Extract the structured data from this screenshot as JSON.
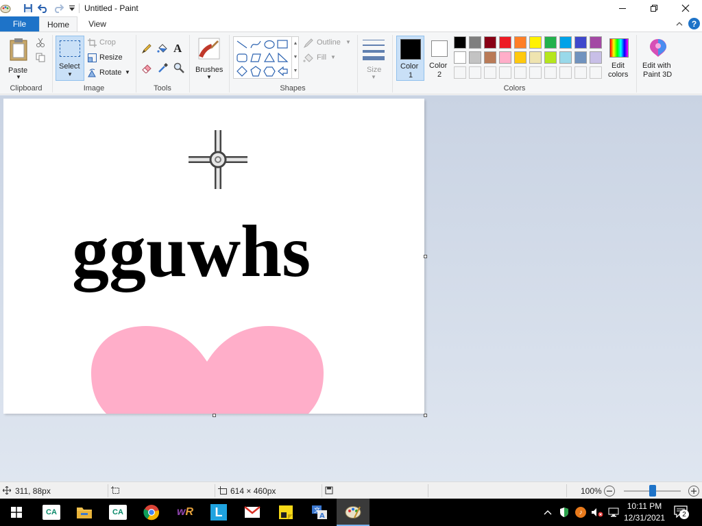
{
  "window": {
    "title": "Untitled - Paint"
  },
  "tabs": {
    "file": "File",
    "home": "Home",
    "view": "View"
  },
  "ribbon": {
    "clipboard": {
      "label": "Clipboard",
      "paste": "Paste"
    },
    "image": {
      "label": "Image",
      "select": "Select",
      "crop": "Crop",
      "resize": "Resize",
      "rotate": "Rotate"
    },
    "tools": {
      "label": "Tools"
    },
    "brushes": {
      "label": "Brushes"
    },
    "shapes": {
      "label": "Shapes",
      "outline": "Outline",
      "fill": "Fill"
    },
    "size": {
      "label": "Size"
    },
    "colors": {
      "label": "Colors",
      "color1": {
        "line1": "Color",
        "line2": "1",
        "value": "#000000"
      },
      "color2": {
        "line1": "Color",
        "line2": "2",
        "value": "#ffffff"
      },
      "edit_colors": {
        "line1": "Edit",
        "line2": "colors"
      },
      "palette_row1": [
        "#000000",
        "#7f7f7f",
        "#880015",
        "#ed1c24",
        "#ff7f27",
        "#fff200",
        "#22b14c",
        "#00a2e8",
        "#3f48cc",
        "#a349a4"
      ],
      "palette_row2": [
        "#ffffff",
        "#c3c3c3",
        "#b97a57",
        "#ffaec9",
        "#ffc90e",
        "#efe4b0",
        "#b5e61d",
        "#99d9ea",
        "#7092be",
        "#c8bfe7"
      ]
    },
    "paint3d": {
      "line1": "Edit with",
      "line2": "Paint 3D"
    }
  },
  "canvas": {
    "text": "gguwhs",
    "heart_color": "#ffaec9"
  },
  "status": {
    "cursor_pos": "311, 88px",
    "canvas_size": "614 × 460px",
    "zoom": "100%",
    "zoom_level": 0.5
  },
  "taskbar": {
    "time": "10:11 PM",
    "date": "12/31/2021",
    "notifications": "2"
  }
}
